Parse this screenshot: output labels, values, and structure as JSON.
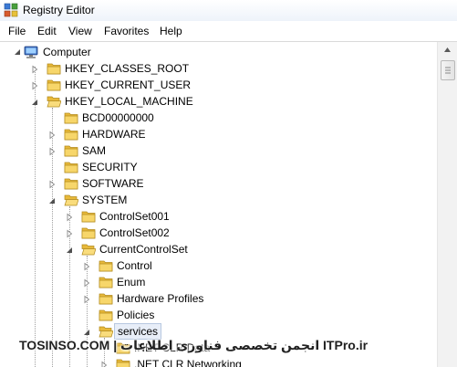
{
  "window": {
    "title": "Registry Editor"
  },
  "menu": [
    "File",
    "Edit",
    "View",
    "Favorites",
    "Help"
  ],
  "tree": {
    "root": "Computer",
    "nodes": [
      {
        "label": "HKEY_CLASSES_ROOT",
        "depth": 1,
        "state": "collapsed"
      },
      {
        "label": "HKEY_CURRENT_USER",
        "depth": 1,
        "state": "collapsed"
      },
      {
        "label": "HKEY_LOCAL_MACHINE",
        "depth": 1,
        "state": "expanded"
      },
      {
        "label": "BCD00000000",
        "depth": 2,
        "state": "none"
      },
      {
        "label": "HARDWARE",
        "depth": 2,
        "state": "collapsed"
      },
      {
        "label": "SAM",
        "depth": 2,
        "state": "collapsed"
      },
      {
        "label": "SECURITY",
        "depth": 2,
        "state": "none"
      },
      {
        "label": "SOFTWARE",
        "depth": 2,
        "state": "collapsed"
      },
      {
        "label": "SYSTEM",
        "depth": 2,
        "state": "expanded"
      },
      {
        "label": "ControlSet001",
        "depth": 3,
        "state": "collapsed"
      },
      {
        "label": "ControlSet002",
        "depth": 3,
        "state": "collapsed"
      },
      {
        "label": "CurrentControlSet",
        "depth": 3,
        "state": "expanded"
      },
      {
        "label": "Control",
        "depth": 4,
        "state": "collapsed"
      },
      {
        "label": "Enum",
        "depth": 4,
        "state": "collapsed"
      },
      {
        "label": "Hardware Profiles",
        "depth": 4,
        "state": "collapsed"
      },
      {
        "label": "Policies",
        "depth": 4,
        "state": "none"
      },
      {
        "label": "services",
        "depth": 4,
        "state": "expanded",
        "selected": true
      },
      {
        "label": ".NET CLR Data",
        "depth": 5,
        "state": "none"
      },
      {
        "label": ".NET CLR Networking",
        "depth": 5,
        "state": "collapsed"
      }
    ]
  },
  "watermark": "TOSINSO.COM | انجمن تخصصی فناوری اطلاعات ITPro.ir"
}
